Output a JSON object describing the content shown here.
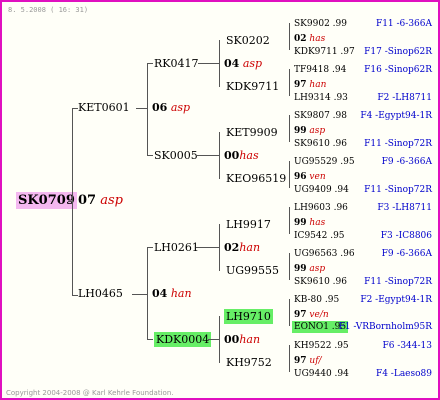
{
  "header": "8. 5.2008 ( 16: 31)",
  "footer": "Copyright 2004-2008 @ Karl Kehrle Foundation.",
  "root": {
    "name": "SK0709",
    "num": "07",
    "pre": "asp"
  },
  "g1": [
    {
      "name": "KET0601",
      "num": "06",
      "pre": "asp"
    },
    {
      "name": "LH0465",
      "num": "04",
      "pre": "han"
    }
  ],
  "g2": [
    {
      "name": "RK0417",
      "num": "04",
      "pre": "asp"
    },
    {
      "name": "SK0005",
      "num": "00",
      "pre": "has"
    },
    {
      "name": "LH0261",
      "num": "02",
      "pre": "han"
    },
    {
      "name": "KDK0004",
      "num": "00",
      "pre": "han"
    }
  ],
  "g3": [
    {
      "name": "SK0202",
      "num": "02",
      "pre": "has"
    },
    {
      "name": "KDK9711",
      "num": "97",
      "pre": "han"
    },
    {
      "name": "KET9909",
      "num": "99",
      "pre": "asp"
    },
    {
      "name": "KEO96519",
      "num": "96",
      "pre": "ven"
    },
    {
      "name": "LH9917",
      "num": "99",
      "pre": "has"
    },
    {
      "name": "UG99555",
      "num": "99",
      "pre": "asp"
    },
    {
      "name": "LH9710",
      "num": "97",
      "pre": "ve/n"
    },
    {
      "name": "KH9752",
      "num": "97",
      "pre": "uf/"
    }
  ],
  "g4": [
    {
      "name": "SK9902 .99",
      "src": "F11 -6-366A"
    },
    {
      "name": "KDK9711 .97",
      "src": "F17 -Sinop62R"
    },
    {
      "name": "TF9418 .94",
      "src": "F16 -Sinop62R"
    },
    {
      "name": "LH9314 .93",
      "src": "F2 -LH8711"
    },
    {
      "name": "SK9807 .98",
      "src": "F4 -Egypt94-1R"
    },
    {
      "name": "SK9610 .96",
      "src": "F11 -Sinop72R"
    },
    {
      "name": "UG95529 .95",
      "src": "F9 -6-366A"
    },
    {
      "name": "UG9409 .94",
      "src": "F11 -Sinop72R"
    },
    {
      "name": "LH9603 .96",
      "src": "F3 -LH8711"
    },
    {
      "name": "IC9542 .95",
      "src": "F3 -IC8806"
    },
    {
      "name": "UG96563 .96",
      "src": "F9 -6-366A"
    },
    {
      "name": "SK9610 .96",
      "src": "F11 -Sinop72R"
    },
    {
      "name": "KB-80 .95",
      "src": "F2 -Egypt94-1R"
    },
    {
      "name": "EONO1 .95",
      "src": "F1 -VRBornholm95R"
    },
    {
      "name": "KH9522 .95",
      "src": "F6 -344-13"
    },
    {
      "name": "UG9440 .94",
      "src": "F4 -Laeso89"
    }
  ]
}
